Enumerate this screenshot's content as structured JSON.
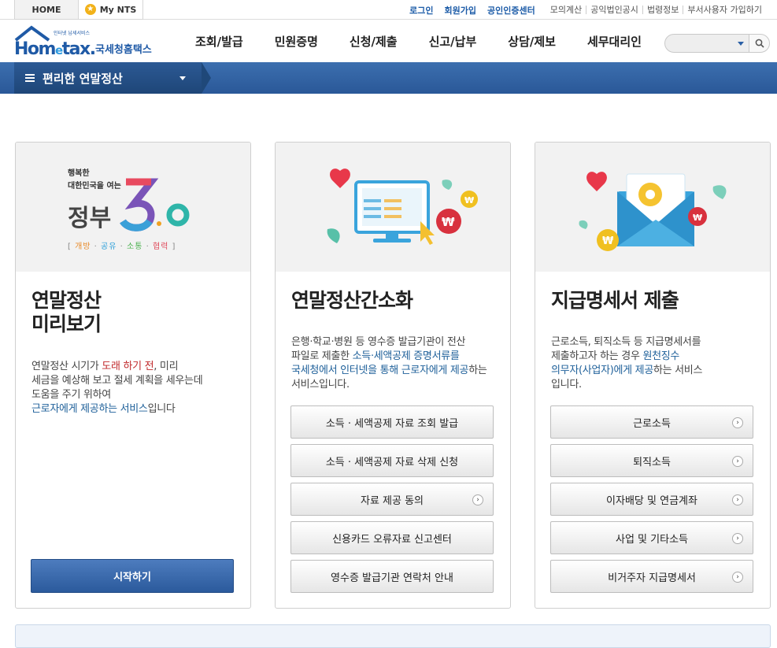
{
  "topbar": {
    "home": "HOME",
    "mynts": "My NTS",
    "links": [
      "로그인",
      "회원가입",
      "공인인증센터"
    ],
    "sublinks": [
      "모의계산",
      "공익법인공시",
      "법령정보",
      "부서사용자 가입하기"
    ]
  },
  "logo": {
    "small": "인터넷 납세서비스",
    "main_pre": "Hom",
    "main_e": "e",
    "main_post": "tax.",
    "kr": "국세청홈택스"
  },
  "nav": [
    "조회/발급",
    "민원증명",
    "신청/제출",
    "신고/납부",
    "상담/제보",
    "세무대리인"
  ],
  "search": {
    "placeholder": ""
  },
  "menubar": {
    "selected": "편리한 연말정산"
  },
  "card1": {
    "img_line1": "행복한",
    "img_line2": "대한민국을 여는",
    "img_gov": "정부",
    "img_ver": "3.0",
    "img_tags": [
      "개방",
      "공유",
      "소통",
      "협력"
    ],
    "title1": "연말정산",
    "title2": "미리보기",
    "desc": [
      {
        "t": "연말정산 시기가 ",
        "c": ""
      },
      {
        "t": "도래 하기 전",
        "c": "red"
      },
      {
        "t": ", 미리 ",
        "c": ""
      }
    ],
    "desc2": "세금을 예상해 보고 절세 계획을 세우는데",
    "desc3": "도움을 주기 위하여",
    "desc4a": "근로자에게 제공하는 서비스",
    "desc4b": "입니다",
    "start": "시작하기"
  },
  "card2": {
    "title": "연말정산간소화",
    "d1": "은행·학교·병원 등 영수증 발급기관이 전산",
    "d2a": "파일로 제출한 ",
    "d2b": "소득·세액공제 증명서류를",
    "d3a": "국세청에서 인터넷을 통해 근로자에게 제공",
    "d3b": "하는",
    "d4": "서비스입니다.",
    "buttons": [
      "소득 · 세액공제 자료 조회 발급",
      "소득 · 세액공제 자료 삭제 신청",
      "자료 제공 동의",
      "신용카드 오류자료 신고센터",
      "영수증 발급기관 연락처 안내"
    ]
  },
  "card3": {
    "title": "지급명세서 제출",
    "d1": "근로소득, 퇴직소득 등 지급명세서를",
    "d2a": "제출하고자 하는 경우 ",
    "d2b": "원천징수",
    "d3a": "의무자(사업자)에게 제공",
    "d3b": "하는 서비스",
    "d4": "입니다.",
    "buttons": [
      "근로소득",
      "퇴직소득",
      "이자배당 및 연금계좌",
      "사업 및 기타소득",
      "비거주자 지급명세서"
    ]
  },
  "colors": {
    "brand_blue": "#2a5898",
    "accent_red": "#c0282a",
    "text_blue": "#1d5f99"
  }
}
